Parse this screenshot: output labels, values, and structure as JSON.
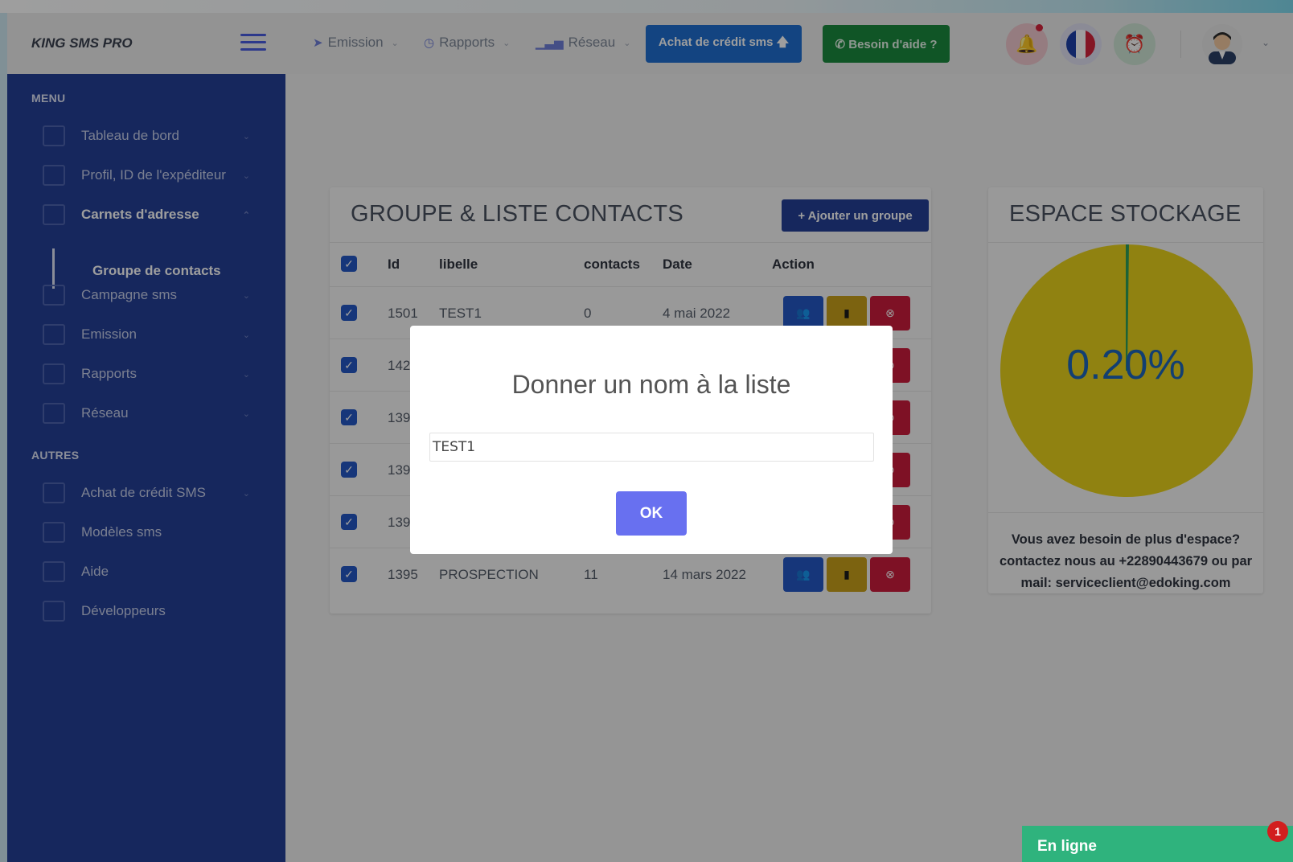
{
  "app": {
    "brand": "KING SMS PRO"
  },
  "topnav": [
    {
      "label": "Emission",
      "icon": "paper-plane-icon"
    },
    {
      "label": "Rapports",
      "icon": "clock-icon"
    },
    {
      "label": "Réseau",
      "icon": "signal-bars-icon"
    }
  ],
  "header": {
    "credit_button": "Achat de crédit sms 🡅",
    "help_button": "✆ Besoin d'aide ?"
  },
  "sidebar": {
    "menu_title": "MENU",
    "items": [
      {
        "label": "Tableau de bord",
        "icon": "rocket-icon"
      },
      {
        "label": "Profil, ID de l'expéditeur",
        "icon": "profile-card-icon"
      },
      {
        "label": "Carnets d'adresse",
        "icon": "address-book-icon",
        "active": true
      },
      {
        "label": "Campagne sms",
        "icon": "diamond-icon"
      },
      {
        "label": "Emission",
        "icon": "monitor-icon"
      },
      {
        "label": "Rapports",
        "icon": "report-icon"
      },
      {
        "label": "Réseau",
        "icon": "wifi-icon"
      }
    ],
    "sub_item": "Groupe de contacts",
    "others_title": "AUTRES",
    "others": [
      {
        "label": "Achat de crédit SMS",
        "icon": "purchase-icon"
      },
      {
        "label": "Modèles sms",
        "icon": "template-icon"
      },
      {
        "label": "Aide",
        "icon": "signpost-icon"
      },
      {
        "label": "Développeurs",
        "icon": "code-icon"
      }
    ]
  },
  "contacts": {
    "title": "GROUPE & LISTE CONTACTS",
    "add_button": "+ Ajouter un groupe",
    "columns": [
      "Id",
      "libelle",
      "contacts",
      "Date",
      "Action"
    ],
    "rows": [
      {
        "id": "1501",
        "libelle": "TEST1",
        "contacts": "0",
        "date": "4 mai 2022"
      },
      {
        "id": "142",
        "libelle": "",
        "contacts": "",
        "date": ""
      },
      {
        "id": "139",
        "libelle": "",
        "contacts": "",
        "date": ""
      },
      {
        "id": "139",
        "libelle": "",
        "contacts": "",
        "date": ""
      },
      {
        "id": "139",
        "libelle": "",
        "contacts": "",
        "date": ""
      },
      {
        "id": "1395",
        "libelle": "PROSPECTION",
        "contacts": "11",
        "date": "14 mars 2022"
      }
    ]
  },
  "storage": {
    "title": "ESPACE STOCKAGE",
    "percent_label": "0.20%",
    "used_fraction": 0.002,
    "note_line1": "Vous avez besoin de plus d'espace?",
    "note_line2": "contactez nous au +22890443679 ou par",
    "note_line3": "mail: serviceclient@edoking.com",
    "colors": {
      "free": "#e9d21c",
      "used": "#2ea05a"
    }
  },
  "modal": {
    "title": "Donner un nom à la liste",
    "input_value": "TEST1",
    "ok_label": "OK"
  },
  "chat": {
    "label": "En ligne",
    "badge": "1"
  }
}
